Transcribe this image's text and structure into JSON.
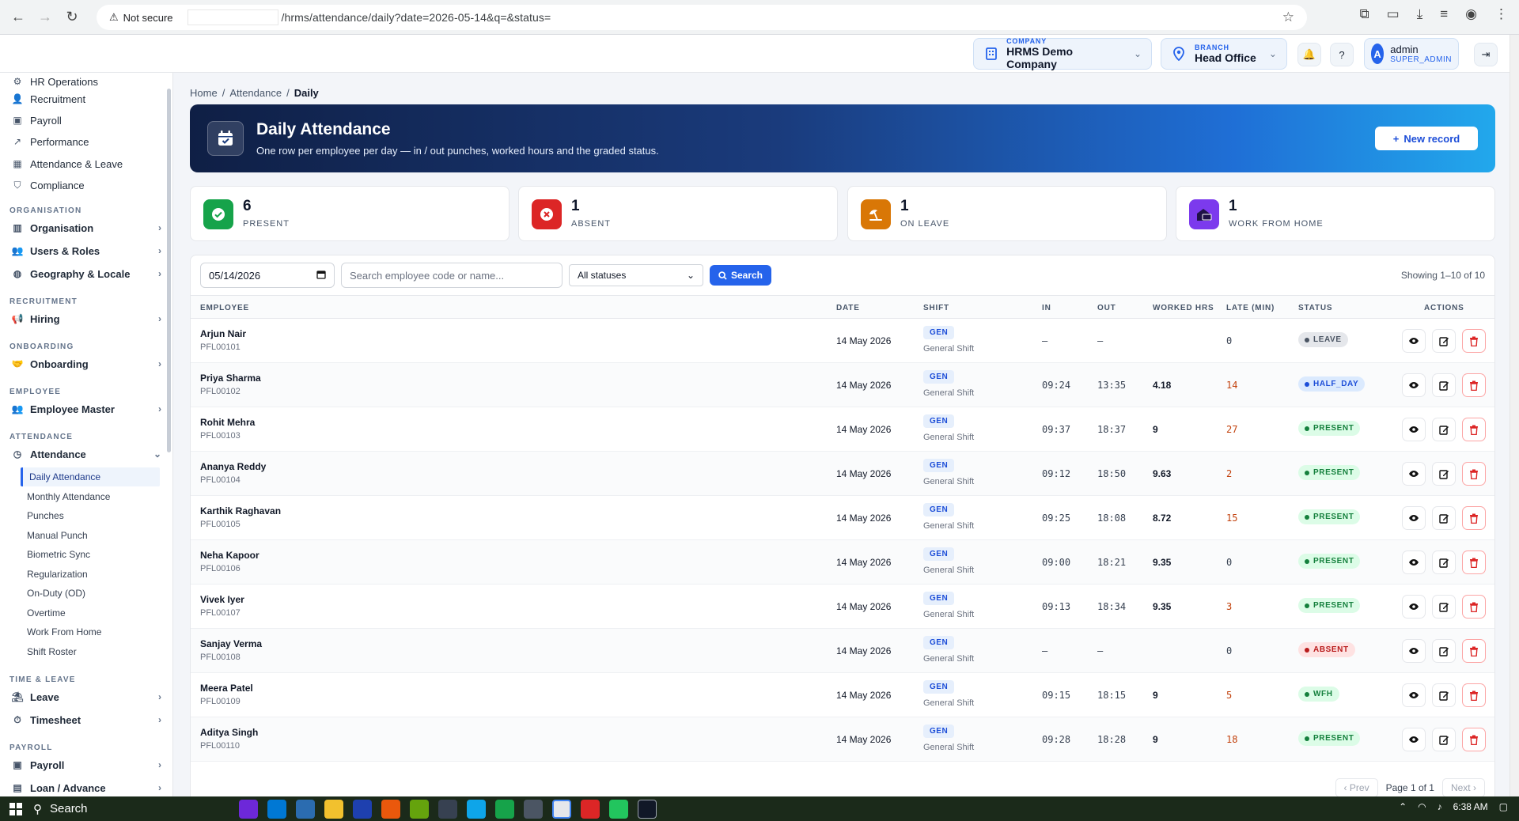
{
  "browser": {
    "security_label": "Not secure",
    "url": "/hrms/attendance/daily?date=2026-05-14&q=&status="
  },
  "topbar": {
    "company_label": "COMPANY",
    "company_value": "HRMS Demo Company",
    "branch_label": "BRANCH",
    "branch_value": "Head Office",
    "user_initial": "A",
    "user_name": "admin",
    "user_role": "SUPER_ADMIN"
  },
  "sidebar": {
    "top_items": [
      {
        "label": "HR Operations",
        "icon": "gear-icon"
      },
      {
        "label": "Recruitment",
        "icon": "user-plus-icon"
      },
      {
        "label": "Payroll",
        "icon": "wallet-icon"
      },
      {
        "label": "Performance",
        "icon": "chart-icon"
      },
      {
        "label": "Attendance & Leave",
        "icon": "calendar-icon"
      },
      {
        "label": "Compliance",
        "icon": "shield-icon"
      }
    ],
    "sections": {
      "organisation": "ORGANISATION",
      "recruitment": "RECRUITMENT",
      "onboarding": "ONBOARDING",
      "employee": "EMPLOYEE",
      "attendance": "ATTENDANCE",
      "time_leave": "TIME & LEAVE",
      "payroll": "PAYROLL"
    },
    "groups": {
      "organisation": "Organisation",
      "users_roles": "Users & Roles",
      "geography": "Geography & Locale",
      "hiring": "Hiring",
      "onboarding": "Onboarding",
      "employee_master": "Employee Master",
      "attendance": "Attendance",
      "leave": "Leave",
      "timesheet": "Timesheet",
      "payroll": "Payroll",
      "loan": "Loan / Advance"
    },
    "attendance_sub": [
      "Daily Attendance",
      "Monthly Attendance",
      "Punches",
      "Manual Punch",
      "Biometric Sync",
      "Regularization",
      "On-Duty (OD)",
      "Overtime",
      "Work From Home",
      "Shift Roster"
    ]
  },
  "breadcrumb": {
    "home": "Home",
    "section": "Attendance",
    "current": "Daily",
    "sep": "/"
  },
  "hero": {
    "title": "Daily Attendance",
    "subtitle": "One row per employee per day — in / out punches, worked hours and the graded status.",
    "new_button": "New record"
  },
  "stats": [
    {
      "value": "6",
      "label": "PRESENT",
      "color": "#16a34a"
    },
    {
      "value": "1",
      "label": "ABSENT",
      "color": "#dc2626"
    },
    {
      "value": "1",
      "label": "ON LEAVE",
      "color": "#d97706"
    },
    {
      "value": "1",
      "label": "WORK FROM HOME",
      "color": "#7c3aed"
    }
  ],
  "filters": {
    "date_value": "05/14/2026",
    "search_placeholder": "Search employee code or name...",
    "status_value": "All statuses",
    "search_button": "Search",
    "showing": "Showing 1–10 of 10"
  },
  "table": {
    "headers": [
      "EMPLOYEE",
      "DATE",
      "SHIFT",
      "IN",
      "OUT",
      "WORKED HRS",
      "LATE (MIN)",
      "STATUS",
      "ACTIONS"
    ],
    "rows": [
      {
        "name": "Arjun Nair",
        "code": "PFL00101",
        "date": "14 May 2026",
        "shift": "GEN",
        "shift_name": "General Shift",
        "in": "–",
        "out": "–",
        "worked": "",
        "late": "0",
        "status": "LEAVE"
      },
      {
        "name": "Priya Sharma",
        "code": "PFL00102",
        "date": "14 May 2026",
        "shift": "GEN",
        "shift_name": "General Shift",
        "in": "09:24",
        "out": "13:35",
        "worked": "4.18",
        "late": "14",
        "status": "HALF_DAY"
      },
      {
        "name": "Rohit Mehra",
        "code": "PFL00103",
        "date": "14 May 2026",
        "shift": "GEN",
        "shift_name": "General Shift",
        "in": "09:37",
        "out": "18:37",
        "worked": "9",
        "late": "27",
        "status": "PRESENT"
      },
      {
        "name": "Ananya Reddy",
        "code": "PFL00104",
        "date": "14 May 2026",
        "shift": "GEN",
        "shift_name": "General Shift",
        "in": "09:12",
        "out": "18:50",
        "worked": "9.63",
        "late": "2",
        "status": "PRESENT"
      },
      {
        "name": "Karthik Raghavan",
        "code": "PFL00105",
        "date": "14 May 2026",
        "shift": "GEN",
        "shift_name": "General Shift",
        "in": "09:25",
        "out": "18:08",
        "worked": "8.72",
        "late": "15",
        "status": "PRESENT"
      },
      {
        "name": "Neha Kapoor",
        "code": "PFL00106",
        "date": "14 May 2026",
        "shift": "GEN",
        "shift_name": "General Shift",
        "in": "09:00",
        "out": "18:21",
        "worked": "9.35",
        "late": "0",
        "status": "PRESENT"
      },
      {
        "name": "Vivek Iyer",
        "code": "PFL00107",
        "date": "14 May 2026",
        "shift": "GEN",
        "shift_name": "General Shift",
        "in": "09:13",
        "out": "18:34",
        "worked": "9.35",
        "late": "3",
        "status": "PRESENT"
      },
      {
        "name": "Sanjay Verma",
        "code": "PFL00108",
        "date": "14 May 2026",
        "shift": "GEN",
        "shift_name": "General Shift",
        "in": "–",
        "out": "–",
        "worked": "",
        "late": "0",
        "status": "ABSENT"
      },
      {
        "name": "Meera Patel",
        "code": "PFL00109",
        "date": "14 May 2026",
        "shift": "GEN",
        "shift_name": "General Shift",
        "in": "09:15",
        "out": "18:15",
        "worked": "9",
        "late": "5",
        "status": "WFH"
      },
      {
        "name": "Aditya Singh",
        "code": "PFL00110",
        "date": "14 May 2026",
        "shift": "GEN",
        "shift_name": "General Shift",
        "in": "09:28",
        "out": "18:28",
        "worked": "9",
        "late": "18",
        "status": "PRESENT"
      }
    ],
    "status_colors": {
      "PRESENT": {
        "bg": "#dcfce7",
        "fg": "#15803d"
      },
      "ABSENT": {
        "bg": "#fee2e2",
        "fg": "#b91c1c"
      },
      "LEAVE": {
        "bg": "#e5e7eb",
        "fg": "#4b5563"
      },
      "HALF_DAY": {
        "bg": "#dbeafe",
        "fg": "#1d4ed8"
      },
      "WFH": {
        "bg": "#dcfce7",
        "fg": "#15803d"
      }
    }
  },
  "pager": {
    "prev": "Prev",
    "info": "Page 1 of 1",
    "next": "Next"
  },
  "taskbar": {
    "search": "Search",
    "time": "6:38 AM"
  }
}
